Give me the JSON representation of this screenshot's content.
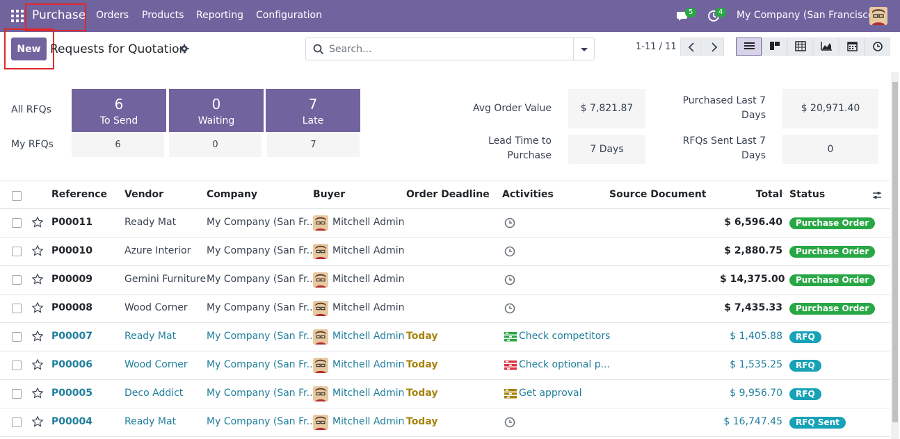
{
  "navbar": {
    "app_name": "Purchase",
    "menu": [
      "Orders",
      "Products",
      "Reporting",
      "Configuration"
    ],
    "messages_count": "5",
    "activities_count": "4",
    "company": "My Company (San Francisco)",
    "bg_color": "#71639e"
  },
  "control": {
    "new_label": "New",
    "title": "Requests for Quotation",
    "search_placeholder": "Search...",
    "pager": "1-11 / 11"
  },
  "dashboard": {
    "all_rfqs_label": "All RFQs",
    "my_rfqs_label": "My RFQs",
    "tiles": [
      {
        "value": "6",
        "label": "To Send"
      },
      {
        "value": "0",
        "label": "Waiting"
      },
      {
        "value": "7",
        "label": "Late"
      }
    ],
    "my_values": [
      "6",
      "0",
      "7"
    ],
    "stats": {
      "avg_order_value_label": "Avg Order Value",
      "avg_order_value": "$ 7,821.87",
      "lead_time_label_1": "Lead Time to",
      "lead_time_label_2": "Purchase",
      "lead_time": "7 Days",
      "purchased_label_1": "Purchased Last 7",
      "purchased_label_2": "Days",
      "purchased": "$ 20,971.40",
      "rfqs_sent_label_1": "RFQs Sent Last 7",
      "rfqs_sent_label_2": "Days",
      "rfqs_sent": "0"
    }
  },
  "table": {
    "columns": [
      "Reference",
      "Vendor",
      "Company",
      "Buyer",
      "Order Deadline",
      "Activities",
      "Source Document",
      "Total",
      "Status"
    ],
    "rows": [
      {
        "ref": "P00011",
        "vendor": "Ready Mat",
        "company": "My Company (San Fr...",
        "buyer": "Mitchell Admin",
        "deadline": "",
        "activity": "",
        "activity_icon": "clock-icon",
        "total": "$ 6,596.40",
        "status": "Purchase Order"
      },
      {
        "ref": "P00010",
        "vendor": "Azure Interior",
        "company": "My Company (San Fr...",
        "buyer": "Mitchell Admin",
        "deadline": "",
        "activity": "",
        "activity_icon": "clock-icon",
        "total": "$ 2,880.75",
        "status": "Purchase Order"
      },
      {
        "ref": "P00009",
        "vendor": "Gemini Furniture",
        "company": "My Company (San Fr...",
        "buyer": "Mitchell Admin",
        "deadline": "",
        "activity": "",
        "activity_icon": "clock-icon",
        "total": "$ 14,375.00",
        "status": "Purchase Order"
      },
      {
        "ref": "P00008",
        "vendor": "Wood Corner",
        "company": "My Company (San Fr...",
        "buyer": "Mitchell Admin",
        "deadline": "",
        "activity": "",
        "activity_icon": "clock-icon",
        "total": "$ 7,435.33",
        "status": "Purchase Order"
      },
      {
        "ref": "P00007",
        "vendor": "Ready Mat",
        "company": "My Company (San Fr...",
        "buyer": "Mitchell Admin",
        "deadline": "Today",
        "activity": "Check competitors",
        "activity_icon": "tasks-icon-green",
        "total": "$ 1,405.88",
        "status": "RFQ"
      },
      {
        "ref": "P00006",
        "vendor": "Wood Corner",
        "company": "My Company (San Fr...",
        "buyer": "Mitchell Admin",
        "deadline": "Today",
        "activity": "Check optional p...",
        "activity_icon": "tasks-icon-red",
        "total": "$ 1,535.25",
        "status": "RFQ"
      },
      {
        "ref": "P00005",
        "vendor": "Deco Addict",
        "company": "My Company (San Fr...",
        "buyer": "Mitchell Admin",
        "deadline": "Today",
        "activity": "Get approval",
        "activity_icon": "tasks-icon-yellow",
        "total": "$ 9,956.70",
        "status": "RFQ"
      },
      {
        "ref": "P00004",
        "vendor": "Ready Mat",
        "company": "My Company (San Fr...",
        "buyer": "Mitchell Admin",
        "deadline": "Today",
        "activity": "",
        "activity_icon": "clock-icon",
        "total": "$ 16,747.45",
        "status": "RFQ Sent"
      }
    ]
  }
}
